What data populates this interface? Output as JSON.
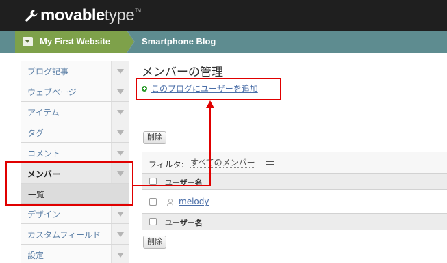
{
  "header": {
    "logo_bold": "movable",
    "logo_light": "type",
    "logo_tm": "TM"
  },
  "breadcrumb": {
    "website": "My First Website",
    "blog": "Smartphone Blog"
  },
  "sidebar": {
    "items": [
      {
        "label": "ブログ記事"
      },
      {
        "label": "ウェブページ"
      },
      {
        "label": "アイテム"
      },
      {
        "label": "タグ"
      },
      {
        "label": "コメント"
      },
      {
        "label": "メンバー"
      },
      {
        "label": "デザイン"
      },
      {
        "label": "カスタムフィールド"
      },
      {
        "label": "設定"
      }
    ],
    "active_sub": "一覧"
  },
  "main": {
    "title": "メンバーの管理",
    "add_link": "このブログにユーザーを追加",
    "delete_label": "削除",
    "filter_label": "フィルタ:",
    "filter_value": "すべてのメンバー",
    "column_header": "ユーザー名",
    "rows": [
      {
        "username": "melody"
      }
    ]
  },
  "annotation_color": "#e00000"
}
